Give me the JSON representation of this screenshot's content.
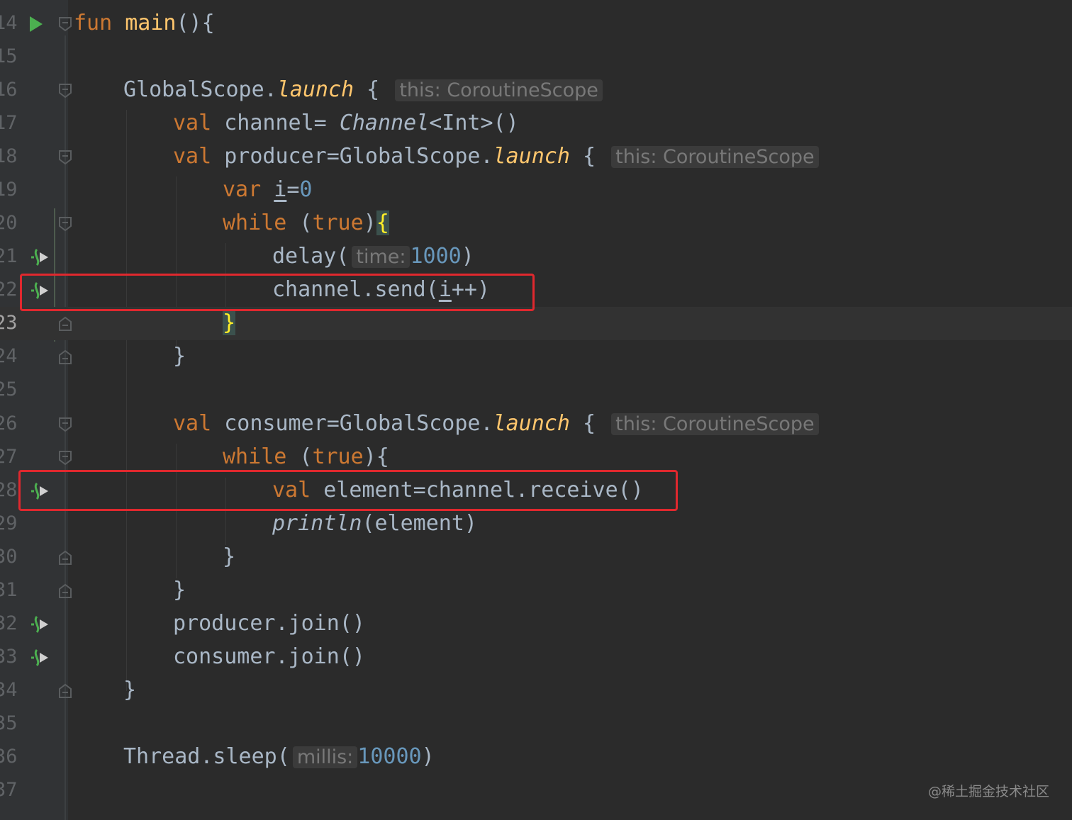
{
  "editor": {
    "colors": {
      "background": "#2b2b2b",
      "gutter": "#313335",
      "keyword": "#cc7832",
      "function": "#ffc66d",
      "default_text": "#a9b7c6",
      "number": "#6897bb",
      "hint_text": "#787878",
      "line_number": "#606366",
      "highlight_box": "#e0282e",
      "gutter_icon": "#4caf50"
    },
    "current_line": "23",
    "lines": [
      {
        "num": "14"
      },
      {
        "num": "15"
      },
      {
        "num": "16"
      },
      {
        "num": "17"
      },
      {
        "num": "18"
      },
      {
        "num": "19"
      },
      {
        "num": "20"
      },
      {
        "num": "21"
      },
      {
        "num": "22"
      },
      {
        "num": "23"
      },
      {
        "num": "24"
      },
      {
        "num": "25"
      },
      {
        "num": "26"
      },
      {
        "num": "27"
      },
      {
        "num": "28"
      },
      {
        "num": "29"
      },
      {
        "num": "30"
      },
      {
        "num": "31"
      },
      {
        "num": "32"
      },
      {
        "num": "33"
      },
      {
        "num": "34"
      },
      {
        "num": "35"
      },
      {
        "num": "36"
      },
      {
        "num": "37"
      }
    ],
    "gutter_icons": {
      "run": "run-arrow-icon",
      "suspend": "suspend-call-icon",
      "fold": "fold-marker-icon"
    },
    "tokens": {
      "fun": "fun",
      "main": "main",
      "parens_brace": "(){",
      "global_scope": "GlobalScope",
      "dot": ".",
      "launch": "launch",
      "brace_open": " {",
      "hint_this": "this: CoroutineScope",
      "val": "val",
      "var": "var",
      "channel_eq": " channel= ",
      "channel_type": "Channel",
      "int_generic": "<Int>()",
      "producer_eq": " producer=GlobalScope.",
      "consumer_eq": " consumer=GlobalScope.",
      "i": "i",
      "eq": "=",
      "zero": "0",
      "while": "while",
      "paren_open": " (",
      "true": "true",
      "paren_close": ")",
      "brace_hl_open": "{",
      "brace_hl_close": "}",
      "brace_open_plain": "{",
      "delay_open": "delay(",
      "hint_time": "time:",
      "n1000": "1000",
      "send_open": "channel.send(",
      "pp_close": "++)",
      "element_eq": " element=channel.receive()",
      "println": "println",
      "element_arg": "(element)",
      "close_brace": "}",
      "producer_join": "producer.join()",
      "consumer_join": "consumer.join()",
      "sleep_open": "Thread.sleep(",
      "hint_millis": "millis:",
      "n10000": "10000"
    }
  },
  "watermark": "@稀土掘金技术社区"
}
